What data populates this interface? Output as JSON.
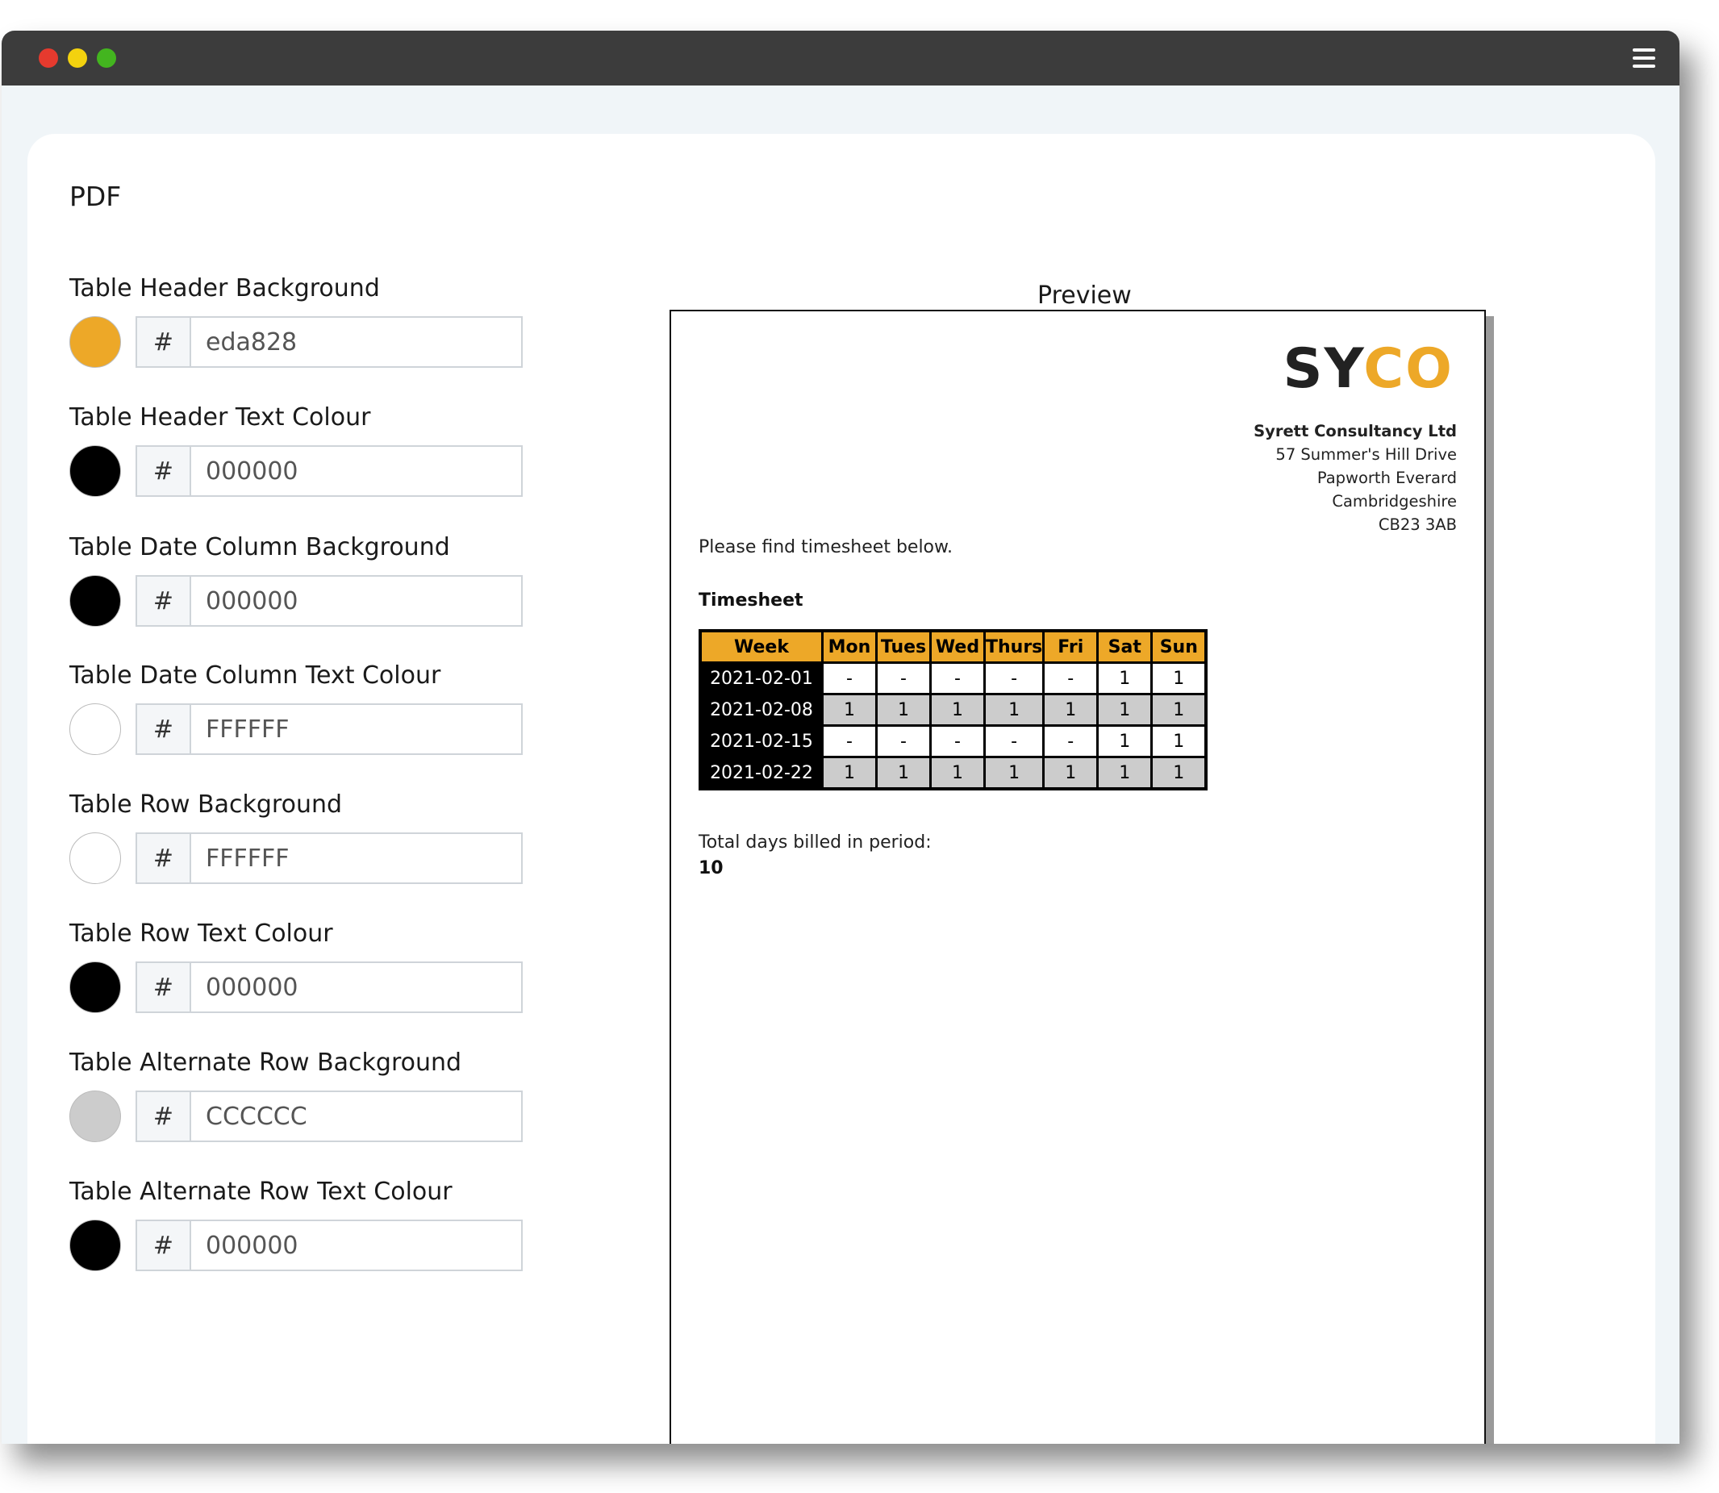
{
  "card": {
    "title": "PDF"
  },
  "settings": [
    {
      "label": "Table Header Background",
      "hash": "#",
      "value": "eda828",
      "color": "#eda828"
    },
    {
      "label": "Table Header Text Colour",
      "hash": "#",
      "value": "000000",
      "color": "#000000"
    },
    {
      "label": "Table Date Column Background",
      "hash": "#",
      "value": "000000",
      "color": "#000000"
    },
    {
      "label": "Table Date Column Text Colour",
      "hash": "#",
      "value": "FFFFFF",
      "color": "#FFFFFF"
    },
    {
      "label": "Table Row Background",
      "hash": "#",
      "value": "FFFFFF",
      "color": "#FFFFFF"
    },
    {
      "label": "Table Row Text Colour",
      "hash": "#",
      "value": "000000",
      "color": "#000000"
    },
    {
      "label": "Table Alternate Row Background",
      "hash": "#",
      "value": "CCCCCC",
      "color": "#CCCCCC"
    },
    {
      "label": "Table Alternate Row Text Colour",
      "hash": "#",
      "value": "000000",
      "color": "#000000"
    }
  ],
  "preview": {
    "label": "Preview",
    "logo": {
      "part1": "SY",
      "part2": "CO"
    },
    "company": {
      "name": "Syrett Consultancy Ltd",
      "address1": "57 Summer's Hill Drive",
      "address2": "Papworth Everard",
      "address3": "Cambridgeshire",
      "postcode": "CB23 3AB"
    },
    "intro": "Please find timesheet below.",
    "timesheet_title": "Timesheet",
    "columns": [
      "Week",
      "Mon",
      "Tues",
      "Wed",
      "Thurs",
      "Fri",
      "Sat",
      "Sun"
    ],
    "rows": [
      {
        "week": "2021-02-01",
        "days": [
          "-",
          "-",
          "-",
          "-",
          "-",
          "1",
          "1"
        ]
      },
      {
        "week": "2021-02-08",
        "days": [
          "1",
          "1",
          "1",
          "1",
          "1",
          "1",
          "1"
        ]
      },
      {
        "week": "2021-02-15",
        "days": [
          "-",
          "-",
          "-",
          "-",
          "-",
          "1",
          "1"
        ]
      },
      {
        "week": "2021-02-22",
        "days": [
          "1",
          "1",
          "1",
          "1",
          "1",
          "1",
          "1"
        ]
      }
    ],
    "total_label": "Total days billed in period:",
    "total_value": "10"
  },
  "colors": {
    "accent": "#eda828",
    "titlebar": "#3c3c3c",
    "window_bg": "#f0f5f8"
  },
  "icons": {
    "menu": "hamburger-menu-icon"
  }
}
